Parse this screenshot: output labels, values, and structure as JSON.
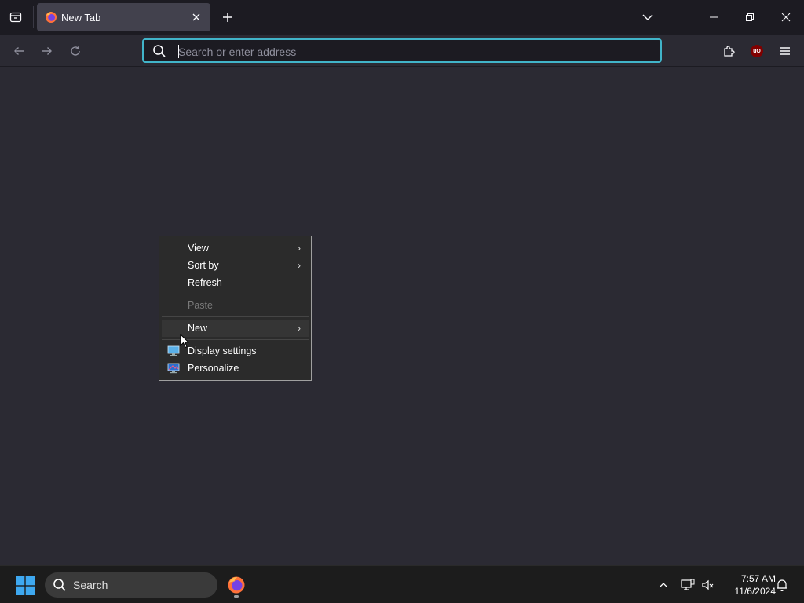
{
  "browser": {
    "tab": {
      "title": "New Tab",
      "favicon": "firefox-icon"
    },
    "urlbar": {
      "placeholder": "Search or enter address",
      "value": ""
    },
    "toolbar_icons": [
      "back-icon",
      "forward-icon",
      "reload-icon",
      "extensions-icon",
      "ublock-icon",
      "menu-icon"
    ],
    "ublock_badge": "uO"
  },
  "context_menu": {
    "items": [
      {
        "label": "View",
        "submenu": true
      },
      {
        "label": "Sort by",
        "submenu": true
      },
      {
        "label": "Refresh"
      },
      {
        "label": "Paste",
        "disabled": true
      },
      {
        "label": "New",
        "submenu": true,
        "highlighted": true
      },
      {
        "label": "Display settings",
        "icon": "display-settings-icon"
      },
      {
        "label": "Personalize",
        "icon": "personalize-icon"
      }
    ]
  },
  "taskbar": {
    "search_label": "Search",
    "pinned_apps": [
      "firefox-icon"
    ],
    "clock": {
      "time": "7:57 AM",
      "date": "11/6/2024"
    }
  },
  "colors": {
    "accent": "#41b4c9",
    "chrome_bg": "#1c1b22",
    "content_bg": "#2b2a33",
    "taskbar_bg": "#1c1c1c"
  }
}
